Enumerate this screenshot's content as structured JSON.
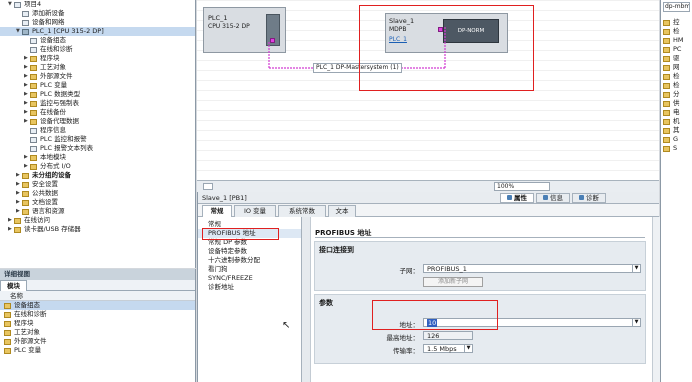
{
  "tree": {
    "items": [
      {
        "label": "项目4",
        "indent": 1,
        "arrow": "▼",
        "icon": "project"
      },
      {
        "label": "添加新设备",
        "indent": 2,
        "arrow": "",
        "icon": "add"
      },
      {
        "label": "设备和网络",
        "indent": 2,
        "arrow": "",
        "icon": "network"
      },
      {
        "label": "PLC_1 [CPU 315-2 DP]",
        "indent": 2,
        "arrow": "▼",
        "icon": "cpu",
        "selected": true
      },
      {
        "label": "设备组态",
        "indent": 3,
        "arrow": "",
        "icon": "config"
      },
      {
        "label": "在线和诊断",
        "indent": 3,
        "arrow": "",
        "icon": "diag"
      },
      {
        "label": "程序块",
        "indent": 3,
        "arrow": "▶",
        "icon": "folder"
      },
      {
        "label": "工艺对象",
        "indent": 3,
        "arrow": "▶",
        "icon": "folder"
      },
      {
        "label": "外部源文件",
        "indent": 3,
        "arrow": "▶",
        "icon": "folder"
      },
      {
        "label": "PLC 变量",
        "indent": 3,
        "arrow": "▶",
        "icon": "folder"
      },
      {
        "label": "PLC 数据类型",
        "indent": 3,
        "arrow": "▶",
        "icon": "folder"
      },
      {
        "label": "监控与强制表",
        "indent": 3,
        "arrow": "▶",
        "icon": "folder"
      },
      {
        "label": "在线备份",
        "indent": 3,
        "arrow": "▶",
        "icon": "folder"
      },
      {
        "label": "设备代理数据",
        "indent": 3,
        "arrow": "▶",
        "icon": "folder"
      },
      {
        "label": "程序信息",
        "indent": 3,
        "arrow": "",
        "icon": "doc"
      },
      {
        "label": "PLC 监控和报警",
        "indent": 3,
        "arrow": "",
        "icon": "doc"
      },
      {
        "label": "PLC 报警文本列表",
        "indent": 3,
        "arrow": "",
        "icon": "doc"
      },
      {
        "label": "本地模块",
        "indent": 3,
        "arrow": "▶",
        "icon": "folder"
      },
      {
        "label": "分布式 I/O",
        "indent": 3,
        "arrow": "▶",
        "icon": "folder"
      },
      {
        "label": "未分组的设备",
        "indent": 2,
        "arrow": "▶",
        "icon": "folder",
        "bold": true
      },
      {
        "label": "安全设置",
        "indent": 2,
        "arrow": "▶",
        "icon": "folder"
      },
      {
        "label": "公共数据",
        "indent": 2,
        "arrow": "▶",
        "icon": "folder"
      },
      {
        "label": "文档设置",
        "indent": 2,
        "arrow": "▶",
        "icon": "folder"
      },
      {
        "label": "语言和资源",
        "indent": 2,
        "arrow": "▶",
        "icon": "folder"
      },
      {
        "label": "在线访问",
        "indent": 1,
        "arrow": "▶",
        "icon": "folder"
      },
      {
        "label": "读卡器/USB 存储器",
        "indent": 1,
        "arrow": "▶",
        "icon": "folder"
      }
    ]
  },
  "detail_view": {
    "title": "详细视图",
    "tab": "模块",
    "column_header": "名称",
    "items": [
      "设备组态",
      "在线和诊断",
      "程序块",
      "工艺对象",
      "外部源文件",
      "PLC 变量"
    ]
  },
  "network": {
    "plc": {
      "name": "PLC_1",
      "type": "CPU 315-2 DP"
    },
    "slave": {
      "name": "Slave_1",
      "type": "MDPB",
      "link": "PLC_1",
      "module": "DP-NORM"
    },
    "bus_label": "PLC_1 DP-Mastersystem (1)",
    "zoom": "100%"
  },
  "properties": {
    "title": "Slave_1 [PB1]",
    "right_tabs": [
      "属性",
      "信息",
      "诊断"
    ],
    "tabs": [
      "常规",
      "IO 变量",
      "系统常数",
      "文本"
    ],
    "nav": [
      "常规",
      "PROFIBUS 地址",
      "常规 DP 参数",
      "设备特定参数",
      "十六进制参数分配",
      "看门狗",
      "SYNC/FREEZE",
      "诊断地址"
    ],
    "section_title": "PROFIBUS 地址",
    "interface": {
      "title": "接口连接到",
      "subnet_label": "子网：",
      "subnet_value": "PROFIBUS_1",
      "add_subnet_button": "添加新子网"
    },
    "params": {
      "title": "参数",
      "address_label": "地址：",
      "address_value": "10",
      "highest_label": "最高地址：",
      "highest_value": "126",
      "rate_label": "传输率：",
      "rate_value": "1.5 Mbps"
    }
  },
  "right_panel": {
    "search": "dp-mbm",
    "items": [
      "控",
      "检",
      "HM",
      "PC",
      "驱",
      "网",
      "检",
      "检",
      "分",
      "供",
      "电",
      "机",
      "其",
      "G",
      "S"
    ]
  },
  "colors": {
    "accent": "#e02020",
    "bus": "#d23cd2",
    "selection": "#c5d9ef",
    "device": "#d9dde2"
  }
}
